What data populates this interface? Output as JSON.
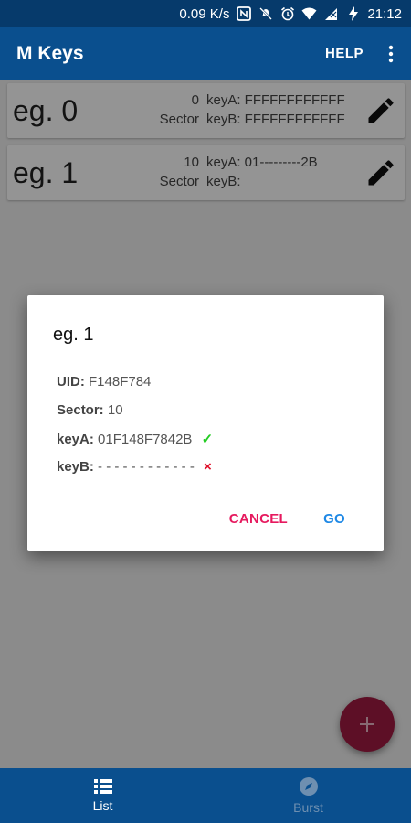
{
  "status_bar": {
    "net_speed": "0.09 K/s",
    "time": "21:12",
    "icons": [
      "nfc-icon",
      "mute-icon",
      "alarm-icon",
      "wifi-icon",
      "signal-icon",
      "battery-charging-icon"
    ]
  },
  "app_bar": {
    "title": "M Keys",
    "help_label": "HELP",
    "more_icon": "more-vert-icon"
  },
  "list": [
    {
      "name": "eg. 0",
      "sector_num": "0",
      "sector_label": "Sector",
      "keyA": "keyA: FFFFFFFFFFFF",
      "keyB": "keyB: FFFFFFFFFFFF"
    },
    {
      "name": "eg. 1",
      "sector_num": "10",
      "sector_label": "Sector",
      "keyA": "keyA: 01---------2B",
      "keyB": "keyB:"
    }
  ],
  "dialog": {
    "title": "eg. 1",
    "uid_label": "UID:",
    "uid_value": "F148F784",
    "sector_label": "Sector:",
    "sector_value": "10",
    "keyA_label": "keyA:",
    "keyA_value": "01F148F7842B",
    "keyA_status": "✓",
    "keyB_label": "keyB:",
    "keyB_value": "- - - - - - - - - - - -",
    "keyB_status": "×",
    "cancel_label": "CANCEL",
    "go_label": "GO"
  },
  "fab": {
    "icon": "plus-icon"
  },
  "bottom_nav": [
    {
      "label": "List",
      "icon": "list-icon",
      "active": true
    },
    {
      "label": "Burst",
      "icon": "compass-icon",
      "active": false
    }
  ],
  "colors": {
    "status_bar": "#063a6b",
    "app_bar": "#0a4f8e",
    "fab": "#a01b43",
    "cancel": "#e6195e",
    "go": "#1e88e5",
    "ok": "#22cc22",
    "bad": "#e0102a"
  }
}
